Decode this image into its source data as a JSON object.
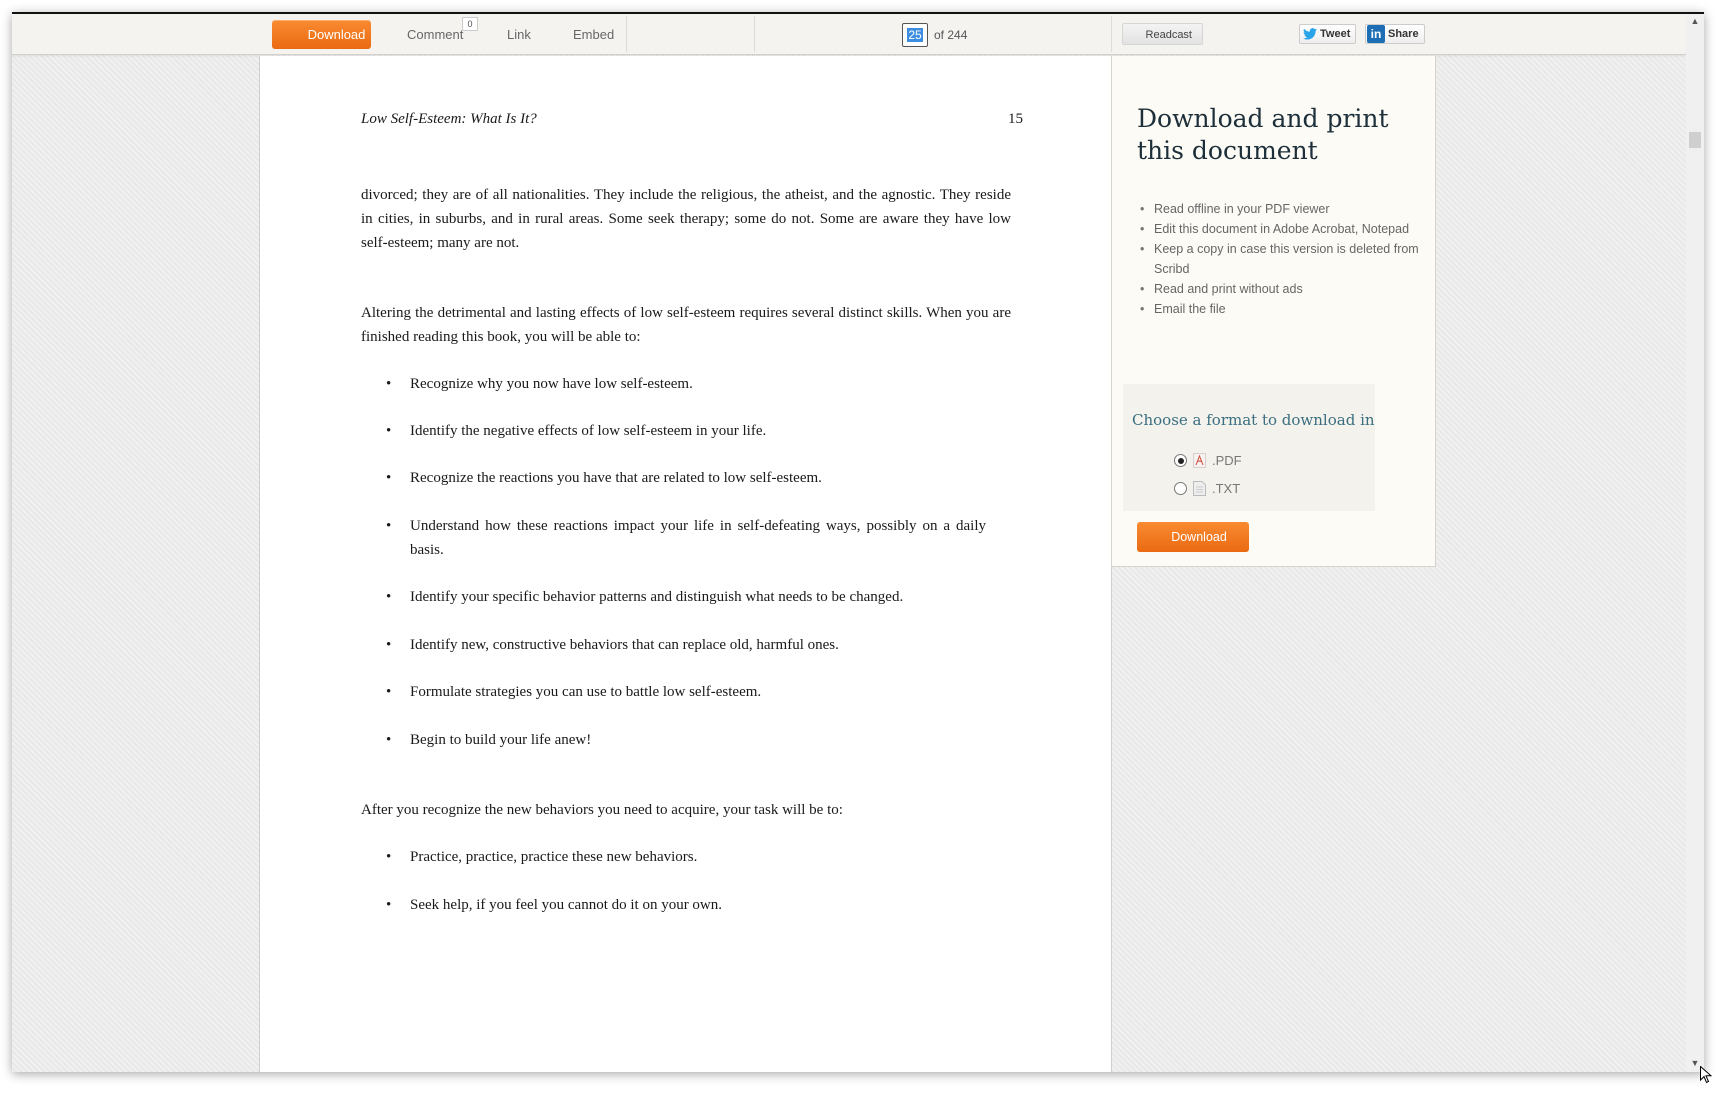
{
  "toolbar": {
    "download_label": "Download",
    "comment_label": "Comment",
    "comment_count": "0",
    "link_label": "Link",
    "embed_label": "Embed",
    "current_page": "25",
    "page_total_label": "of 244",
    "readcast_label": "Readcast",
    "tweet_label": "Tweet",
    "share_label": "Share",
    "linkedin_glyph": "in"
  },
  "document": {
    "running_head": "Low Self-Esteem: What Is It?",
    "page_number": "15",
    "paragraphs": [
      "divorced; they are of all nationalities. They include the religious, the atheist, and the agnostic. They reside in cities, in suburbs, and in rural areas. Some seek therapy; some do not. Some are aware they have low self-esteem; many are not.",
      "Altering the detrimental and lasting effects of low self-esteem requires several distinct skills. When you are finished reading this book, you will be able to:",
      "After you recognize the new behaviors you need to acquire, your task will be to:"
    ],
    "bullets_1": [
      "Recognize why you now have low self-esteem.",
      "Identify the negative effects of low self-esteem in your life.",
      "Recognize the reactions you have that are related to low self-esteem.",
      "Understand how these reactions impact your life in self-defeating ways, possibly on a daily basis.",
      "Identify your specific behavior patterns and distinguish what needs to be changed.",
      "Identify new, constructive behaviors that can replace old, harmful ones.",
      "Formulate strategies you can use to battle low self-esteem.",
      "Begin to build your life anew!"
    ],
    "bullets_2": [
      "Practice, practice, practice these new behaviors.",
      "Seek help, if you feel you cannot do it on your own."
    ],
    "bullet_glyph": "•"
  },
  "side_panel": {
    "title": "Download and print this document",
    "benefits": [
      "Read offline in your PDF viewer",
      "Edit this document in Adobe Acrobat, Notepad",
      "Keep a copy in case this version is deleted from Scribd",
      "Read and print without ads",
      "Email the file"
    ],
    "format_title": "Choose a format to download in",
    "formats": [
      {
        "label": ".PDF",
        "selected": true,
        "icon": "pdf-file-icon"
      },
      {
        "label": ".TXT",
        "selected": false,
        "icon": "txt-file-icon"
      }
    ],
    "download_label": "Download"
  },
  "colors": {
    "accent_orange": "#f07a1f",
    "title_dark": "#1c2f3a",
    "format_title": "#3a6e80",
    "page_highlight": "#3d8de0",
    "linkedin_blue": "#1d6eb5",
    "twitter_blue": "#2aa4e8"
  }
}
